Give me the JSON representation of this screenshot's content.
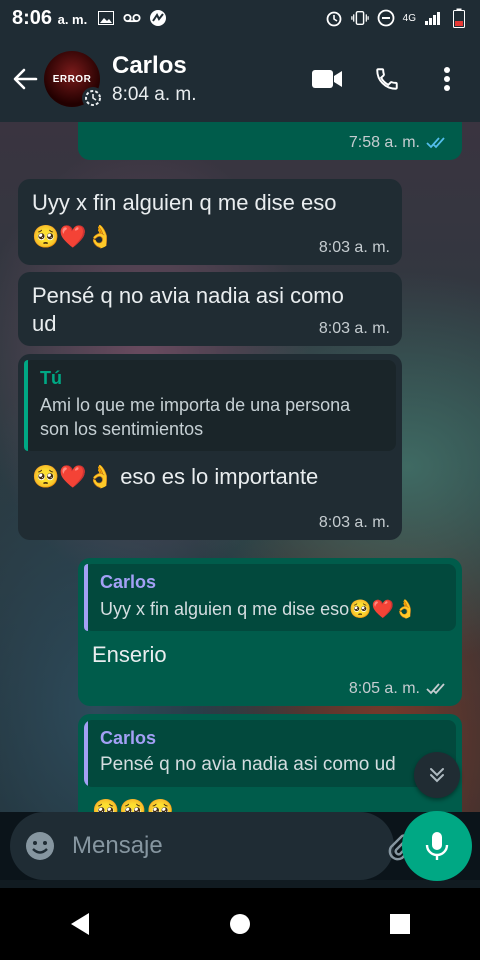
{
  "status": {
    "time": "8:06",
    "ampm": "a. m.",
    "network": "4G"
  },
  "header": {
    "contact_name": "Carlos",
    "last_seen": "8:04 a. m.",
    "avatar_text": "ERROR"
  },
  "messages": [
    {
      "time": "7:58 a. m."
    },
    {
      "text": "Uyy x fin alguien q me dise eso",
      "emoji": "🥺❤️👌",
      "time": "8:03 a. m."
    },
    {
      "text": "Pensé q no avia nadia asi como ud",
      "time": "8:03 a. m."
    },
    {
      "quote_author": "Tú",
      "quote_text": "Ami lo que me importa de una persona son los sentimientos",
      "emoji": "🥺❤️👌",
      "text": "eso es lo importante",
      "time": "8:03 a. m."
    },
    {
      "quote_author": "Carlos",
      "quote_text": "Uyy x fin alguien q me dise eso🥺❤️👌",
      "text": "Enserio",
      "time": "8:05 a. m."
    },
    {
      "quote_author": "Carlos",
      "quote_text": "Pensé q no avia nadia asi como ud",
      "emoji": "🥺🥺🥺"
    }
  ],
  "composer": {
    "placeholder": "Mensaje"
  },
  "colors": {
    "header": "#1f2c34",
    "incoming": "#202c33",
    "outgoing": "#005c4b",
    "accent": "#00a884",
    "tick_blue": "#53bdeb"
  },
  "icons": [
    "image-icon",
    "voicemail-icon",
    "whatsapp-icon",
    "alarm-icon",
    "vibrate-icon",
    "dnd-icon",
    "signal-icon",
    "battery-icon",
    "back-arrow-icon",
    "video-call-icon",
    "phone-icon",
    "menu-icon",
    "emoji-icon",
    "attach-icon",
    "camera-icon",
    "mic-icon",
    "scroll-down-icon"
  ]
}
